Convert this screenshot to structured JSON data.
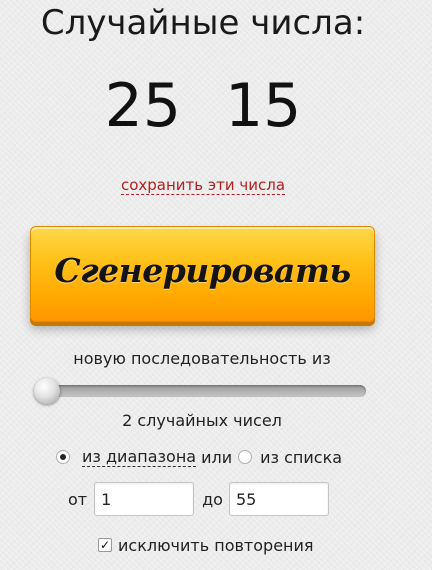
{
  "title": "Случайные числа:",
  "results": [
    "25",
    "15"
  ],
  "save_link": "сохранить эти числа",
  "generate_button": "Сгенерировать",
  "sequence_label": "новую последовательность из",
  "count": {
    "value": 2,
    "min": 1,
    "text": "2 случайных чисел"
  },
  "mode": {
    "range_label": "из диапазона",
    "or_text": "или",
    "list_label": "из списка",
    "selected": "range"
  },
  "range": {
    "from_label": "от",
    "from_value": "1",
    "to_label": "до",
    "to_value": "55"
  },
  "exclude": {
    "label": "исключить повторения",
    "checked": true
  },
  "icons": {
    "checkmark": "check-icon"
  },
  "colors": {
    "link": "#b32020",
    "button": "#ffb300"
  }
}
